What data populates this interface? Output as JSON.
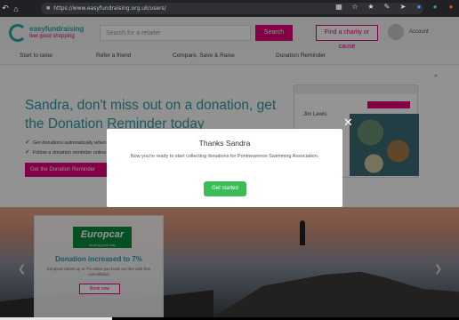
{
  "browser": {
    "url": "https://www.easyfundraising.org.uk/users/"
  },
  "header": {
    "logo_line1": "easyfundraising",
    "logo_line2": "feel good shopping",
    "search_placeholder": "Search for a retailer",
    "search_button": "Search",
    "fund_button": "Find a charity or cause",
    "account_label": "Account"
  },
  "menu": {
    "items": [
      "Start to raise",
      "Refer a friend",
      "Compare, Save & Raise",
      "Donation Reminder"
    ]
  },
  "hero": {
    "title": "Sandra, don't miss out on a donation, get the Donation Reminder today",
    "check1": "Get donations automatically when you shop",
    "check2": "Follow a donation reminder online",
    "button": "Get the Donation Reminder",
    "preview_name": "Jim Lewis"
  },
  "promo": {
    "brand": "Europcar",
    "brand_sub": "Moving your way",
    "title": "Donation increased to 7%",
    "desc": "Europcar raises up to 7% when you book car hire with free cancellation",
    "button": "Book now"
  },
  "modal": {
    "title": "Thanks Sandra",
    "body": "Now you're ready to start collecting donations for Pontnewnnon Swimming Association.",
    "button": "Get started"
  },
  "colors": {
    "brand_teal": "#2d9aa2",
    "brand_pink": "#e2007a",
    "cta_green": "#3cbc54"
  }
}
